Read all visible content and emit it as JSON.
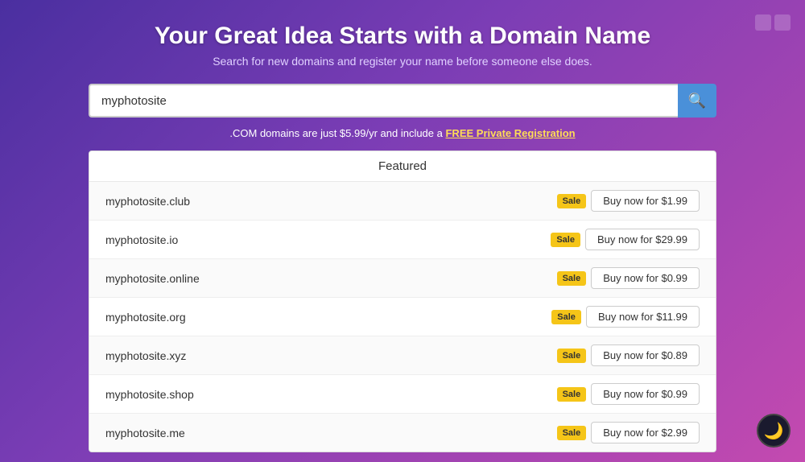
{
  "page": {
    "title": "Your Great Idea Starts with a Domain Name",
    "subtitle": "Search for new domains and register your name before someone else does."
  },
  "search": {
    "value": "myphotosite",
    "placeholder": "myphotosite",
    "button_icon": "🔍"
  },
  "promo": {
    "text_before": ".COM domains are just $5.99/yr and include a ",
    "link_text": "FREE Private Registration",
    "text_after": ""
  },
  "featured_label": "Featured",
  "domains": [
    {
      "name": "myphotosite.club",
      "sale": "Sale",
      "action": "Buy now for $1.99"
    },
    {
      "name": "myphotosite.io",
      "sale": "Sale",
      "action": "Buy now for $29.99"
    },
    {
      "name": "myphotosite.online",
      "sale": "Sale",
      "action": "Buy now for $0.99"
    },
    {
      "name": "myphotosite.org",
      "sale": "Sale",
      "action": "Buy now for $11.99"
    },
    {
      "name": "myphotosite.xyz",
      "sale": "Sale",
      "action": "Buy now for $0.89"
    },
    {
      "name": "myphotosite.shop",
      "sale": "Sale",
      "action": "Buy now for $0.99"
    },
    {
      "name": "myphotosite.me",
      "sale": "Sale",
      "action": "Buy now for $2.99"
    }
  ],
  "dark_mode_icon": "🌙"
}
